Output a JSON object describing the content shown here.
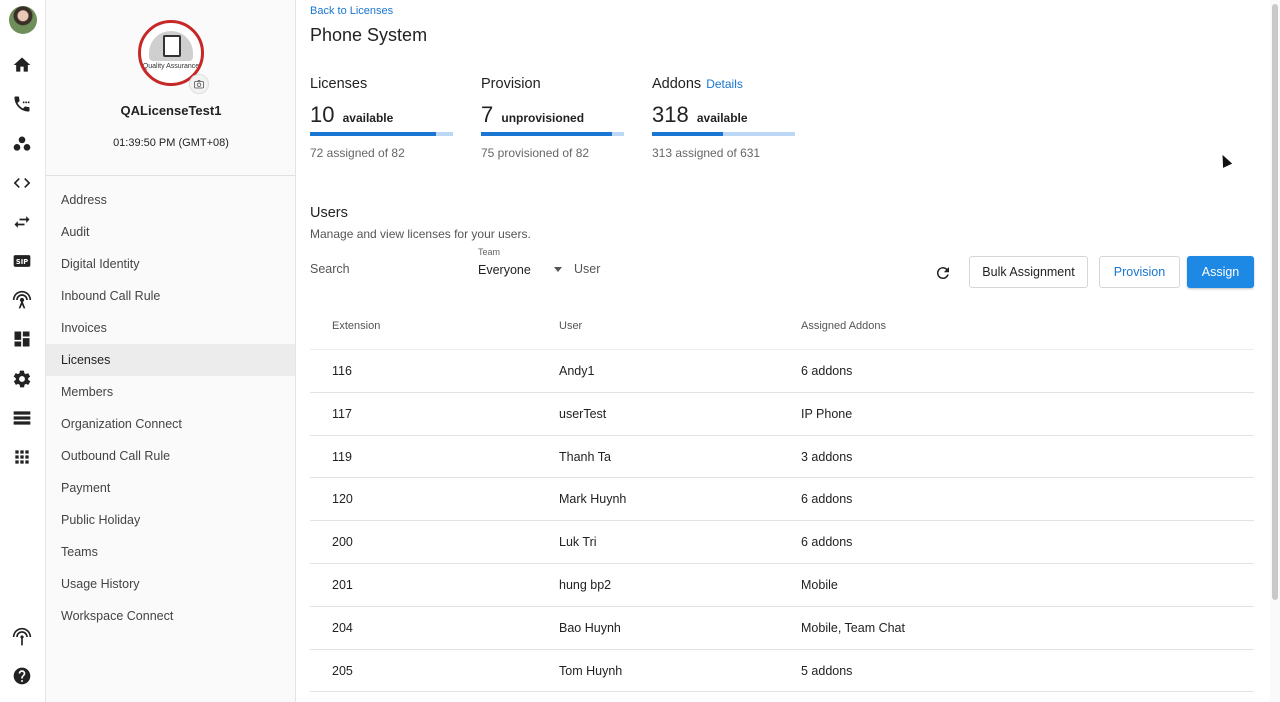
{
  "rail": {
    "icons": [
      "avatar",
      "home-icon",
      "phone-icon",
      "groups-icon",
      "code-icon",
      "transfer-icon",
      "sip-icon",
      "antenna-icon",
      "dashboard-icon",
      "gear-icon",
      "server-icon",
      "apps-grid-icon",
      "broadcast-icon",
      "help-icon"
    ]
  },
  "org": {
    "logo_text": "Quality Assurance",
    "name": "QALicenseTest1",
    "time": "01:39:50 PM (GMT+08)"
  },
  "menu": [
    "Address",
    "Audit",
    "Digital Identity",
    "Inbound Call Rule",
    "Invoices",
    "Licenses",
    "Members",
    "Organization Connect",
    "Outbound Call Rule",
    "Payment",
    "Public Holiday",
    "Teams",
    "Usage History",
    "Workspace Connect"
  ],
  "active_menu": "Licenses",
  "page": {
    "back": "Back to Licenses",
    "title": "Phone System"
  },
  "stats": {
    "licenses": {
      "label": "Licenses",
      "count": "10",
      "unit": "available",
      "sub": "72 assigned of 82",
      "fill_fraction": 0.878
    },
    "provision": {
      "label": "Provision",
      "count": "7",
      "unit": "unprovisioned",
      "sub": "75 provisioned of 82",
      "fill_fraction": 0.915
    },
    "addons": {
      "label": "Addons",
      "link": "Details",
      "count": "318",
      "unit": "available",
      "sub": "313 assigned of 631",
      "fill_fraction": 0.496
    }
  },
  "users": {
    "title": "Users",
    "desc": "Manage and view licenses for your users.",
    "search_placeholder": "Search",
    "team_label": "Team",
    "team_value": "Everyone",
    "user_placeholder": "User",
    "buttons": {
      "bulk": "Bulk Assignment",
      "provision": "Provision",
      "assign": "Assign"
    }
  },
  "table": {
    "headers": [
      "Extension",
      "User",
      "Assigned Addons"
    ],
    "rows": [
      [
        "116",
        "Andy1",
        "6 addons"
      ],
      [
        "117",
        "userTest",
        "IP Phone"
      ],
      [
        "119",
        "Thanh Ta",
        "3 addons"
      ],
      [
        "120",
        "Mark Huynh",
        "6 addons"
      ],
      [
        "200",
        "Luk Tri",
        "6 addons"
      ],
      [
        "201",
        "hung bp2",
        "Mobile"
      ],
      [
        "204",
        "Bao Huynh",
        "Mobile, Team Chat"
      ],
      [
        "205",
        "Tom Huynh",
        "5 addons"
      ]
    ]
  },
  "colors": {
    "accent": "#1976d2",
    "primary_button": "#1e88e5",
    "bar_track": "#bcd8f5",
    "logo_ring": "#c62828"
  }
}
